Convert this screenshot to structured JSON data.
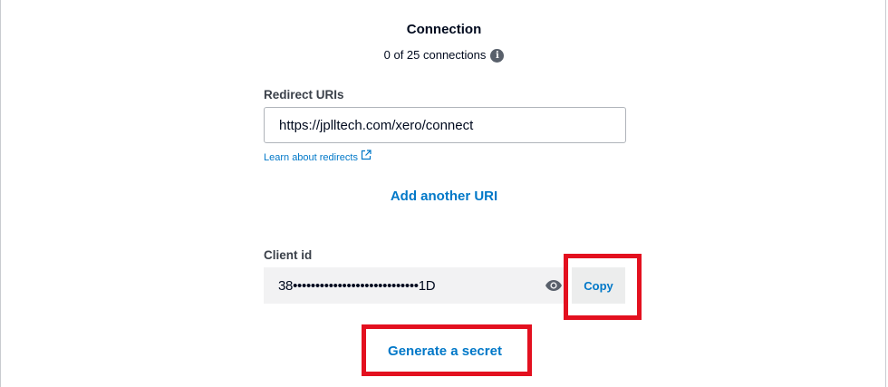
{
  "connection": {
    "title": "Connection",
    "count_text": "0 of 25 connections",
    "info_icon": "info-icon"
  },
  "redirect": {
    "label": "Redirect URIs",
    "value": "https://jplltech.com/xero/connect",
    "learn_link": "Learn about redirects",
    "add_another": "Add another URI"
  },
  "client": {
    "label": "Client id",
    "value": "38••••••••••••••••••••••••••••1D",
    "copy_label": "Copy",
    "eye_icon": "eye-icon"
  },
  "secret": {
    "generate_label": "Generate a secret"
  },
  "colors": {
    "link_blue": "#0078c8",
    "highlight_red": "#e3101f",
    "field_gray": "#f2f2f3"
  }
}
